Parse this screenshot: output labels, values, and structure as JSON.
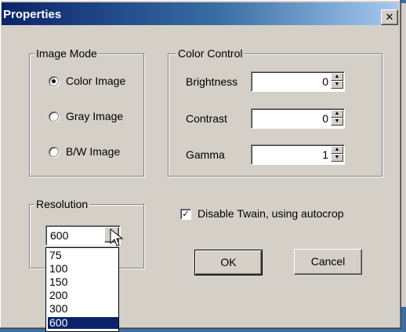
{
  "window": {
    "title": "Properties",
    "close_glyph": "✕"
  },
  "image_mode": {
    "legend": "Image Mode",
    "options": [
      {
        "label": "Color Image",
        "selected": true
      },
      {
        "label": "Gray Image",
        "selected": false
      },
      {
        "label": "B/W Image",
        "selected": false
      }
    ]
  },
  "color_control": {
    "legend": "Color Control",
    "fields": [
      {
        "label": "Brightness",
        "value": "0"
      },
      {
        "label": "Contrast",
        "value": "0"
      },
      {
        "label": "Gamma",
        "value": "1"
      }
    ]
  },
  "resolution": {
    "legend": "Resolution",
    "selected": "600",
    "options": [
      "75",
      "100",
      "150",
      "200",
      "300",
      "600"
    ]
  },
  "options": {
    "disable_twain_label": "Disable Twain, using autocrop",
    "disable_twain_checked": true
  },
  "buttons": {
    "ok": "OK",
    "cancel": "Cancel"
  },
  "icons": {
    "close": "close-icon",
    "spin_up": "spin-up-icon",
    "spin_down": "spin-down-icon",
    "dropdown": "chevron-down-icon",
    "cursor": "mouse-pointer-icon",
    "check": "checkmark-icon"
  },
  "colors": {
    "titlebar_start": "#0a246a",
    "titlebar_end": "#a6caf0",
    "face": "#d4d0c8",
    "desktop": "#3a6ea5",
    "selection": "#0a246a"
  }
}
